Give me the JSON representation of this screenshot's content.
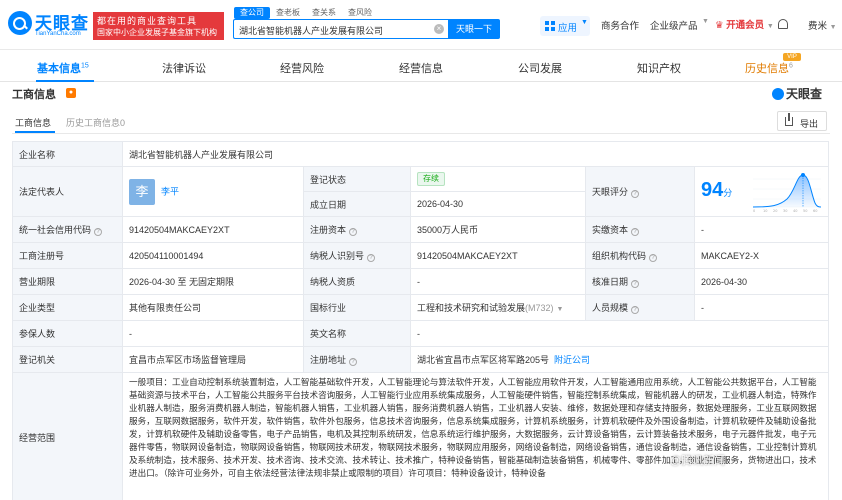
{
  "header": {
    "logo_cn": "天眼查",
    "logo_en": "TianYanCha.com",
    "slogan_line1": "都在用的商业查询工具",
    "slogan_line2": "国家中小企业发展子基金旗下机构",
    "search_tabs": [
      "查公司",
      "查老板",
      "查关系",
      "查风险"
    ],
    "search_value": "湖北省智能机器人产业发展有限公司",
    "search_button": "天眼一下",
    "app_label": "应用",
    "nav": [
      "商务合作",
      "企业级产品"
    ],
    "vip_label": "开通会员",
    "user_name": "费米"
  },
  "section_tabs": [
    {
      "label": "基本信息",
      "count": "15"
    },
    {
      "label": "法律诉讼",
      "count": ""
    },
    {
      "label": "经营风险",
      "count": ""
    },
    {
      "label": "经营信息",
      "count": ""
    },
    {
      "label": "公司发展",
      "count": ""
    },
    {
      "label": "知识产权",
      "count": ""
    },
    {
      "label": "历史信息",
      "count": "6"
    }
  ],
  "vip_tag": "VIP",
  "card": {
    "title": "工商信息",
    "brand": "天眼查",
    "sub_tabs": [
      "工商信息",
      "历史工商信息0"
    ],
    "export_label": "导出"
  },
  "info": {
    "company_name_label": "企业名称",
    "company_name": "湖北省智能机器人产业发展有限公司",
    "legal_rep_label": "法定代表人",
    "legal_rep_avatar": "李",
    "legal_rep": "李平",
    "reg_status_label": "登记状态",
    "reg_status": "存续",
    "founded_label": "成立日期",
    "founded": "2026-04-30",
    "score_label": "天眼评分",
    "score": "94",
    "score_unit": "分",
    "credit_code_label": "统一社会信用代码",
    "credit_code": "91420504MAKCAEY2XT",
    "reg_capital_label": "注册资本",
    "reg_capital": "35000万人民币",
    "paid_capital_label": "实缴资本",
    "paid_capital": "-",
    "reg_no_label": "工商注册号",
    "reg_no": "420504110001494",
    "taxpayer_id_label": "纳税人识别号",
    "taxpayer_id": "91420504MAKCAEY2XT",
    "org_code_label": "组织机构代码",
    "org_code": "MAKCAEY2-X",
    "term_label": "营业期限",
    "term": "2026-04-30 至 无固定期限",
    "taxpayer_qual_label": "纳税人资质",
    "taxpayer_qual": "-",
    "approval_label": "核准日期",
    "approval": "2026-04-30",
    "type_label": "企业类型",
    "type": "其他有限责任公司",
    "industry_label": "国标行业",
    "industry": "工程和技术研究和试验发展",
    "industry_code": "(M732)",
    "staff_size_label": "人员规模",
    "staff_size": "-",
    "insured_label": "参保人数",
    "insured": "-",
    "en_name_label": "英文名称",
    "en_name": "-",
    "authority_label": "登记机关",
    "authority": "宜昌市点军区市场监督管理局",
    "address_label": "注册地址",
    "address": "湖北省宜昌市点军区将军路205号",
    "nearby_label": "附近公司",
    "scope_label": "经营范围",
    "scope": "一般项目：工业自动控制系统装置制造，人工智能基础软件开发，人工智能理论与算法软件开发，人工智能应用软件开发，人工智能通用应用系统，人工智能公共数据平台，人工智能基础资源与技术平台，人工智能公共服务平台技术咨询服务，人工智能行业应用系统集成服务，人工智能硬件销售，智能控制系统集成，智能机器人的研发，工业机器人制造，特殊作业机器人制造，服务消费机器人制造，智能机器人销售，工业机器人销售，服务消费机器人销售，工业机器人安装、维修，数据处理和存储支持服务，数据处理服务，工业互联网数据服务，互联网数据服务，软件开发，软件销售，软件外包服务，信息技术咨询服务，信息系统集成服务，计算机系统服务，计算机软硬件及外围设备制造，计算机软硬件及辅助设备批发，计算机软硬件及辅助设备零售，电子产品销售，电机及其控制系统研发，信息系统运行维护服务，大数据服务，云计算设备销售，云计算装备技术服务，电子元器件批发，电子元器件零售，物联网设备制造，物联网设备销售，物联网技术研发，物联网技术服务，物联网应用服务，网络设备制造，网络设备销售，通信设备制造，通信设备销售，工业控制计算机及系统制造，技术服务、技术开发、技术咨询、技术交流、技术转让、技术推广，特种设备销售，智能基础制造装备销售，机械零件、零部件加工，创业空间服务，货物进出口，技术进出口。（除许可业务外，可自主依法经营法律法规非禁止或限制的项目）许可项目：特种设备设计，特种设备"
  },
  "watermark": "@腾讯新闻"
}
